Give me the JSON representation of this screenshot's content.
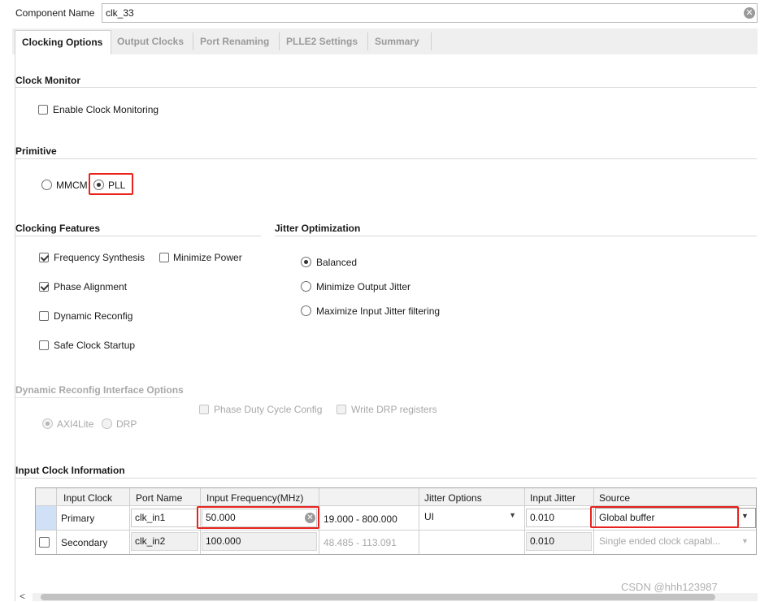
{
  "component": {
    "label": "Component Name",
    "value": "clk_33"
  },
  "tabs": [
    "Clocking Options",
    "Output Clocks",
    "Port Renaming",
    "PLLE2 Settings",
    "Summary"
  ],
  "clock_monitor": {
    "title": "Clock Monitor",
    "enable_label": "Enable Clock Monitoring",
    "enabled": false
  },
  "primitive": {
    "title": "Primitive",
    "options": [
      "MMCM",
      "PLL"
    ],
    "selected": "PLL"
  },
  "features": {
    "title": "Clocking Features",
    "frequency_synthesis": "Frequency Synthesis",
    "minimize_power": "Minimize Power",
    "phase_alignment": "Phase Alignment",
    "dynamic_reconfig": "Dynamic Reconfig",
    "safe_clock_startup": "Safe Clock Startup"
  },
  "jitter": {
    "title": "Jitter Optimization",
    "balanced": "Balanced",
    "min_output": "Minimize Output Jitter",
    "max_input": "Maximize Input Jitter filtering",
    "selected": "Balanced"
  },
  "dynamic_interface": {
    "title": "Dynamic Reconfig Interface Options",
    "axi": "AXI4Lite",
    "drp": "DRP",
    "phase_duty": "Phase Duty Cycle Config",
    "write_drp": "Write DRP registers"
  },
  "input_clock": {
    "title": "Input Clock Information",
    "headers": [
      "Input Clock",
      "Port Name",
      "Input Frequency(MHz)",
      "",
      "Jitter Options",
      "Input Jitter",
      "Source"
    ],
    "rows": [
      {
        "name": "Primary",
        "port": "clk_in1",
        "freq": "50.000",
        "range": "19.000 - 800.000",
        "jitter_opt": "UI",
        "jitter": "0.010",
        "source": "Global buffer"
      },
      {
        "name": "Secondary",
        "port": "clk_in2",
        "freq": "100.000",
        "range": "48.485 - 113.091",
        "jitter_opt": "",
        "jitter": "0.010",
        "source": "Single ended clock capabl..."
      }
    ]
  },
  "watermark": "CSDN @hhh123987"
}
